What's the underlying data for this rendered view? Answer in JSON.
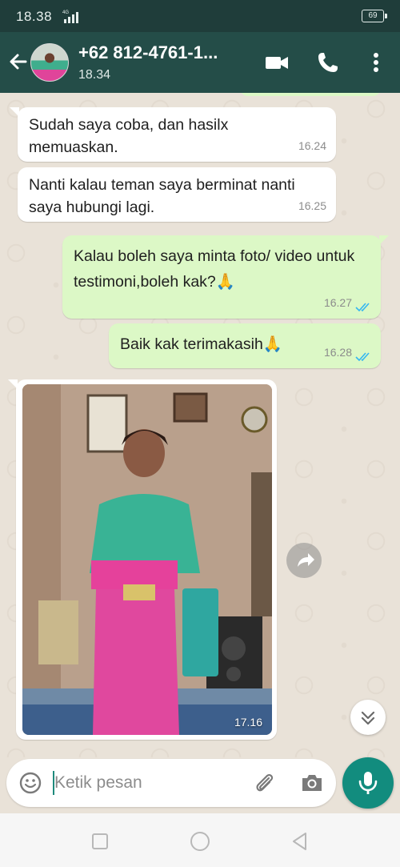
{
  "status_bar": {
    "time": "18.38",
    "network": "4G",
    "battery": "69"
  },
  "header": {
    "contact_name": "+62 812-4761-1...",
    "subtitle": "18.34"
  },
  "messages": [
    {
      "direction": "incoming",
      "text": "Sudah saya coba, dan hasilx memuaskan.",
      "time": "16.24"
    },
    {
      "direction": "incoming",
      "text": "Nanti kalau teman saya berminat nanti saya hubungi lagi.",
      "time": "16.25"
    },
    {
      "direction": "outgoing",
      "text": "Kalau boleh saya minta foto/ video untuk testimoni,boleh kak?🙏",
      "time": "16.27",
      "status": "read"
    },
    {
      "direction": "outgoing",
      "text": "Baik kak terimakasih🙏",
      "time": "16.28",
      "status": "read"
    },
    {
      "direction": "incoming",
      "type": "image",
      "time": "17.16"
    }
  ],
  "composer": {
    "placeholder": "Ketik pesan"
  },
  "colors": {
    "header": "#244d48",
    "status_bar": "#1f3d3a",
    "outgoing_bubble": "#dcf8c6",
    "incoming_bubble": "#ffffff",
    "read_ticks": "#34b7f1",
    "accent": "#128c7e"
  },
  "icons": {
    "back": "arrow-left-icon",
    "video": "video-camera-icon",
    "call": "phone-icon",
    "menu": "more-vertical-icon",
    "forward": "forward-icon",
    "scroll": "chevron-double-down-icon",
    "emoji": "emoji-icon",
    "attach": "paperclip-icon",
    "camera": "camera-icon",
    "mic": "mic-icon"
  }
}
